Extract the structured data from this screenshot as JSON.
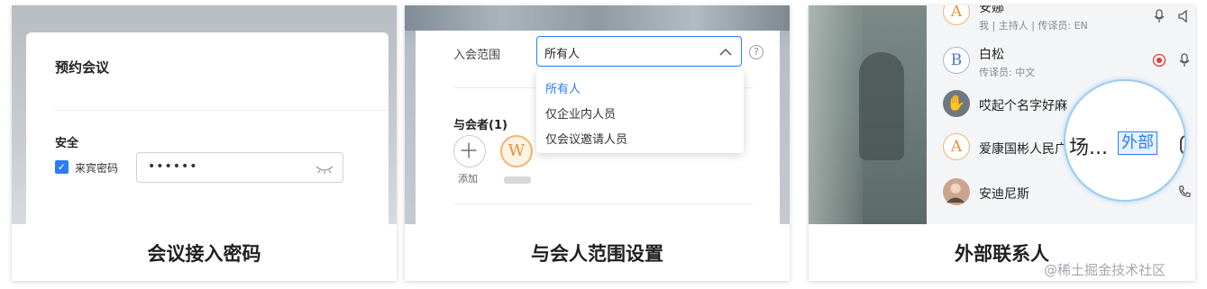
{
  "card1": {
    "caption": "会议接入密码",
    "title": "预约会议",
    "section": "安全",
    "checkbox_label": "来宾密码",
    "checkbox_checked": true,
    "password_value": "••••••",
    "eye_icon": "eye-closed-icon"
  },
  "card2": {
    "caption": "与会人范围设置",
    "range_label": "入会范围",
    "selected": "所有人",
    "options": [
      "所有人",
      "仅企业内人员",
      "仅会议邀请人员"
    ],
    "participants_label": "与会者(1)",
    "add_label": "添加",
    "avatar_letter": "W",
    "help_icon": "?"
  },
  "card3": {
    "caption": "外部联系人",
    "items": [
      {
        "avatar_letter": "A",
        "name": "安娜",
        "sub": "我 | 主持人 | 传译员: EN"
      },
      {
        "avatar_letter": "B",
        "name": "白松",
        "sub": "传译员: 中文"
      },
      {
        "avatar_letter": "✋",
        "name": "哎起个名字好麻",
        "sub": ""
      },
      {
        "avatar_letter": "A",
        "name": "爱康国彬人民广场",
        "sub": ""
      },
      {
        "avatar_letter": "",
        "name": "安迪尼斯",
        "sub": ""
      }
    ],
    "magnifier_text": "场...",
    "magnifier_badge": "外部"
  },
  "watermark": "@稀土掘金技术社区",
  "colors": {
    "accent": "#2b7df6",
    "record_red": "#e53935",
    "avatar_orange": "#e8923a"
  }
}
